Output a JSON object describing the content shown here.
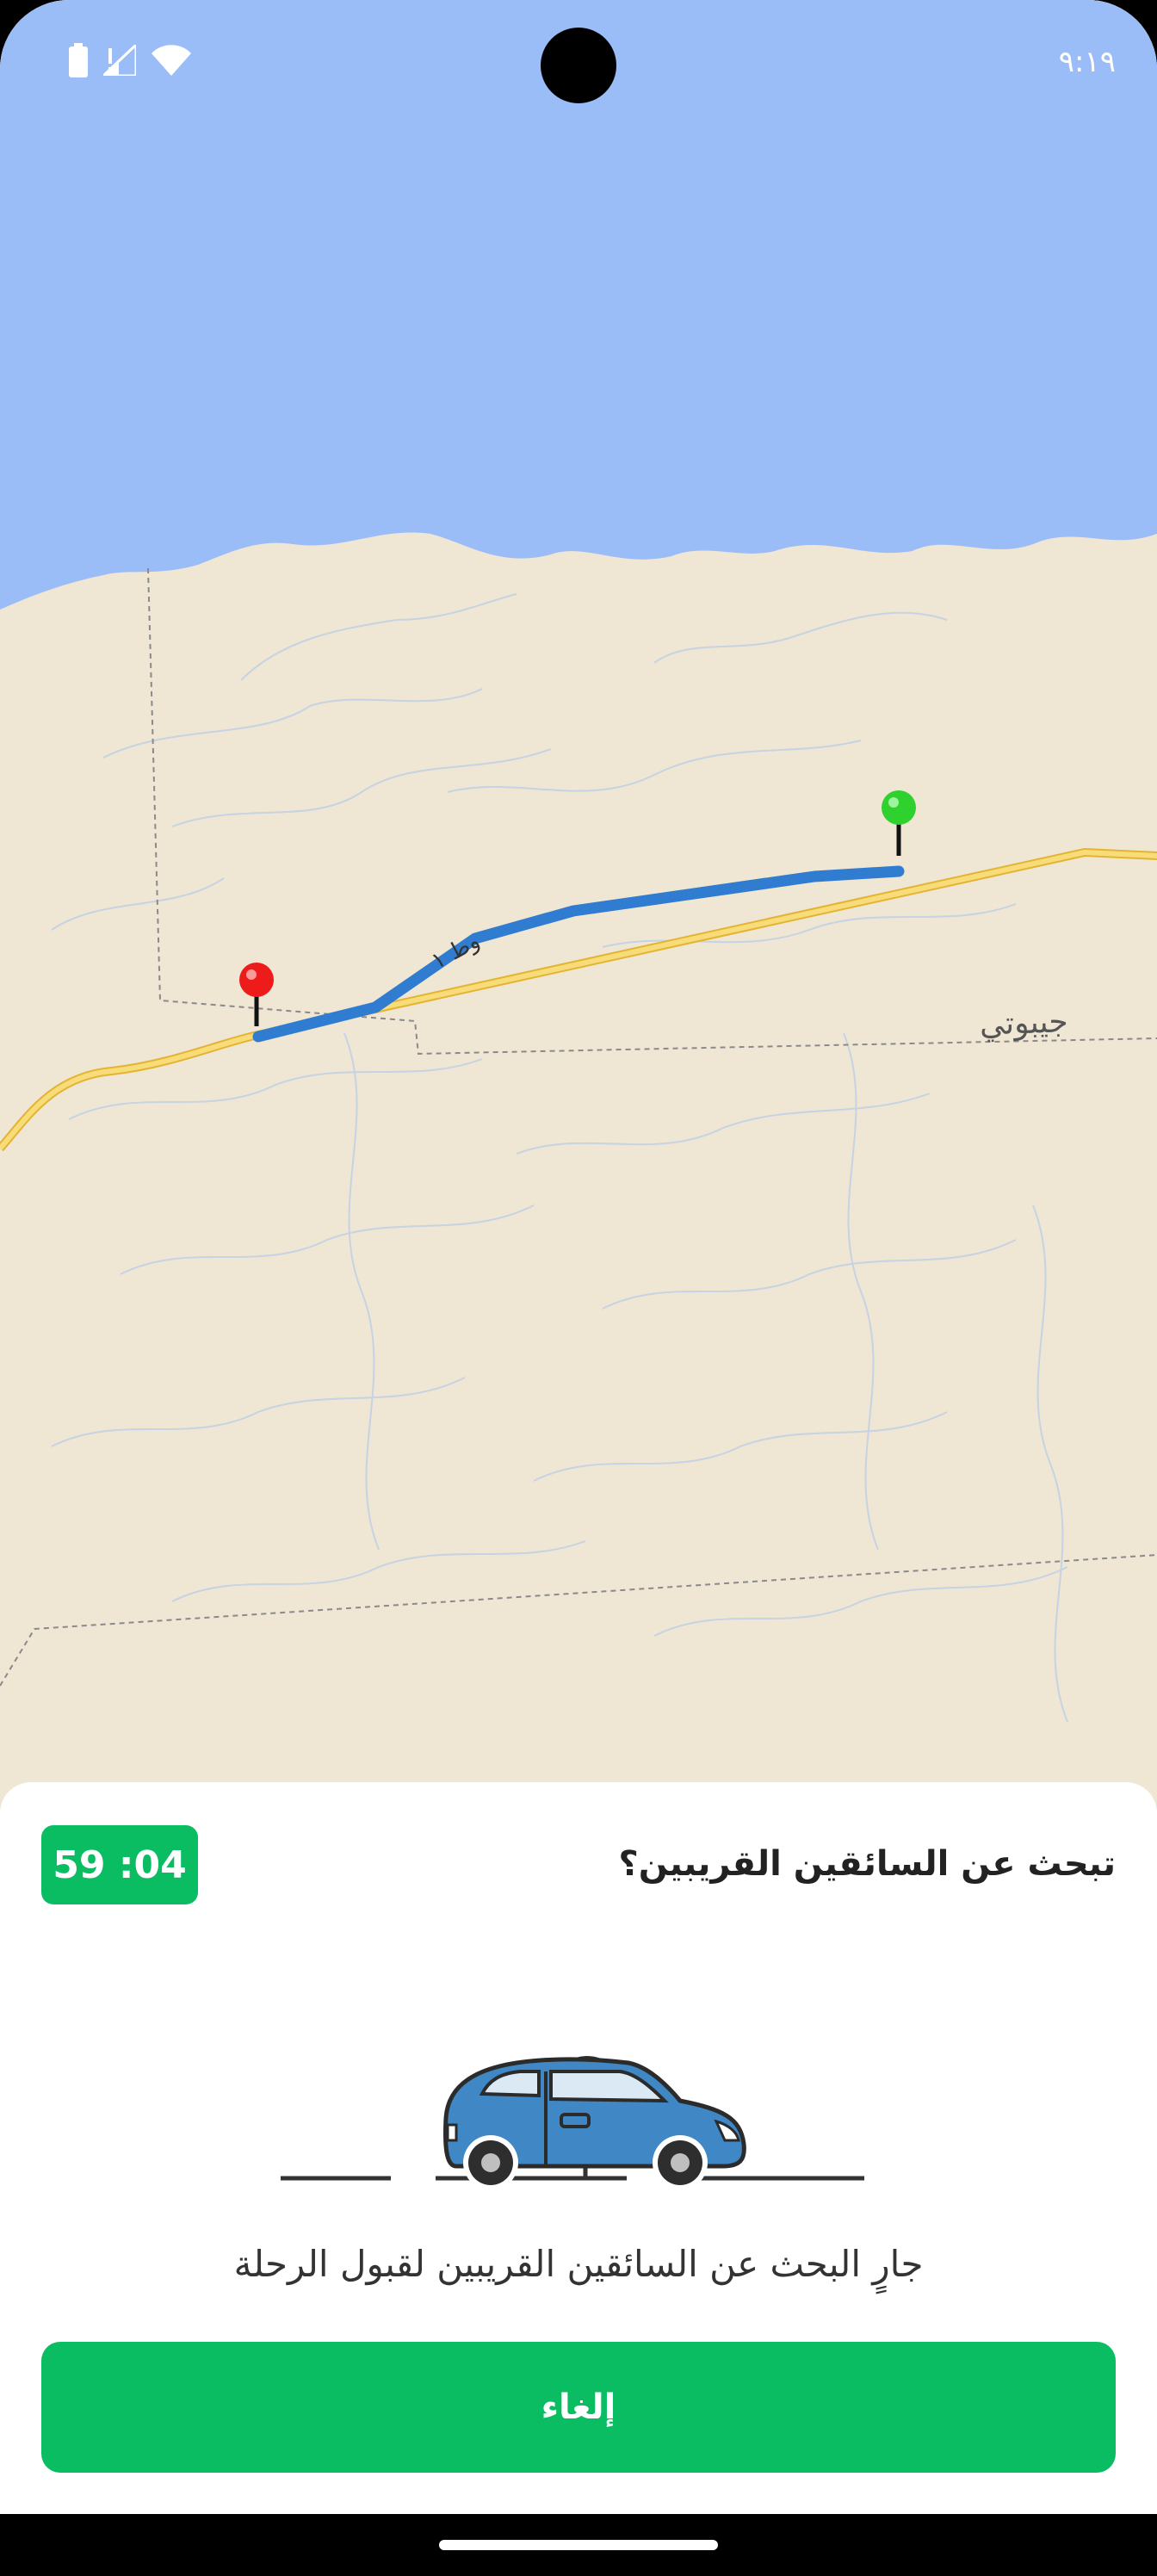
{
  "status": {
    "time": "٩:١٩"
  },
  "map": {
    "city_label": "جيبوتي",
    "road_label": "وط ١"
  },
  "sheet": {
    "title": "تبحث عن السائقين القريبين؟",
    "timer": "59 :04",
    "message": "جارٍ البحث عن السائقين القريبين لقبول الرحلة",
    "cancel_label": "إلغاء"
  },
  "colors": {
    "accent": "#0bbd62",
    "route": "#2f7cd1",
    "sea": "#9bbdf7",
    "land": "#f0e6d4"
  }
}
